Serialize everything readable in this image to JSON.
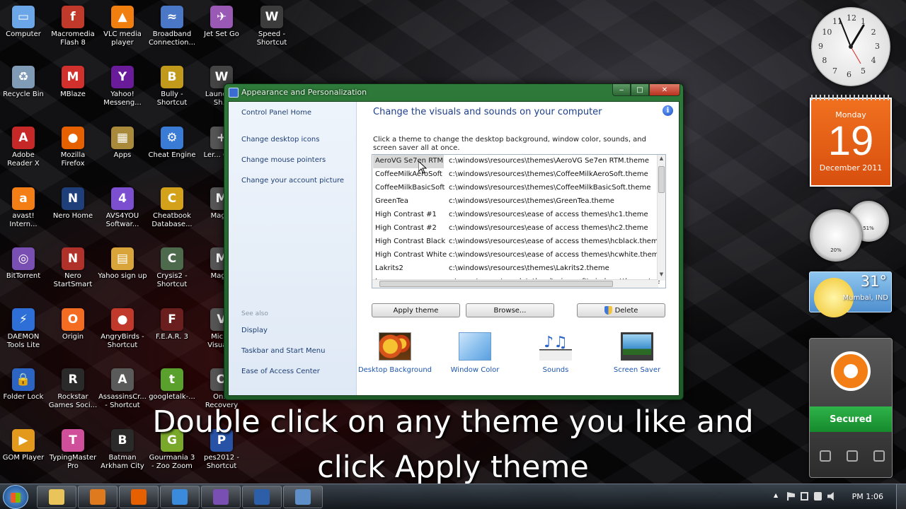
{
  "desktop_icons": [
    {
      "label": "Computer",
      "icon": "computer-icon",
      "color": "#6aa6e8",
      "glyph": "▭"
    },
    {
      "label": "Macromedia Flash 8",
      "icon": "flash-icon",
      "color": "#c0392b",
      "glyph": "f"
    },
    {
      "label": "VLC media player",
      "icon": "vlc-icon",
      "color": "#f07f0f",
      "glyph": "▲"
    },
    {
      "label": "Broadband Connection...",
      "icon": "network-icon",
      "color": "#4a78c7",
      "glyph": "≈"
    },
    {
      "label": "Jet Set Go",
      "icon": "game-icon",
      "color": "#9b59b6",
      "glyph": "✈"
    },
    {
      "label": "Speed - Shortcut",
      "icon": "speed-icon",
      "color": "#3c3c3c",
      "glyph": "W"
    },
    {
      "label": "Recycle Bin",
      "icon": "recycle-bin-icon",
      "color": "#7f9bb5",
      "glyph": "♻"
    },
    {
      "label": "MBlaze",
      "icon": "mblaze-icon",
      "color": "#d0312d",
      "glyph": "M"
    },
    {
      "label": "Yahoo! Messeng...",
      "icon": "yahoo-icon",
      "color": "#6a1b9a",
      "glyph": "Y"
    },
    {
      "label": "Bully - Shortcut",
      "icon": "bully-icon",
      "color": "#c29a1b",
      "glyph": "B"
    },
    {
      "label": "Launc... - Sh...",
      "icon": "launcher-icon",
      "color": "#444",
      "glyph": "W"
    },
    {
      "label": "Adobe Reader X",
      "icon": "adobe-reader-icon",
      "color": "#c62828",
      "glyph": "A"
    },
    {
      "label": "Mozilla Firefox",
      "icon": "firefox-icon",
      "color": "#e66000",
      "glyph": "●"
    },
    {
      "label": "Apps",
      "icon": "apps-icon",
      "color": "#a88a3a",
      "glyph": "▦"
    },
    {
      "label": "Cheat Engine",
      "icon": "cheat-engine-icon",
      "color": "#3a7bd5",
      "glyph": "⚙"
    },
    {
      "label": "Ler... Ga...",
      "icon": "game2-icon",
      "color": "#555",
      "glyph": "+"
    },
    {
      "label": "avast! Intern...",
      "icon": "avast-icon",
      "color": "#f27e15",
      "glyph": "a"
    },
    {
      "label": "Nero Home",
      "icon": "nero-home-icon",
      "color": "#1f3f7a",
      "glyph": "N"
    },
    {
      "label": "AVS4YOU Softwar...",
      "icon": "avs-icon",
      "color": "#7b4fcf",
      "glyph": "4"
    },
    {
      "label": "Cheatbook Database...",
      "icon": "cheatbook-icon",
      "color": "#d4a21a",
      "glyph": "C"
    },
    {
      "label": "Mag...",
      "icon": "mag-icon",
      "color": "#555",
      "glyph": "M"
    },
    {
      "label": "BitTorrent",
      "icon": "bittorrent-icon",
      "color": "#7a4fb3",
      "glyph": "◎"
    },
    {
      "label": "Nero StartSmart",
      "icon": "nero-startsmart-icon",
      "color": "#b0302a",
      "glyph": "N"
    },
    {
      "label": "Yahoo sign up",
      "icon": "yahoo-signup-icon",
      "color": "#d9a43a",
      "glyph": "▤"
    },
    {
      "label": "Crysis2 - Shortcut",
      "icon": "crysis-icon",
      "color": "#4d6a4d",
      "glyph": "C"
    },
    {
      "label": "Mag...",
      "icon": "mag2-icon",
      "color": "#555",
      "glyph": "M"
    },
    {
      "label": "DAEMON Tools Lite",
      "icon": "daemon-tools-icon",
      "color": "#2d6fd6",
      "glyph": "⚡"
    },
    {
      "label": "Origin",
      "icon": "origin-icon",
      "color": "#f36c21",
      "glyph": "O"
    },
    {
      "label": "AngryBirds - Shortcut",
      "icon": "angry-birds-icon",
      "color": "#c0392b",
      "glyph": "●"
    },
    {
      "label": "F.E.A.R. 3",
      "icon": "fear-icon",
      "color": "#6b1e1e",
      "glyph": "F"
    },
    {
      "label": "Micr... Visual...",
      "icon": "visual-icon",
      "color": "#555",
      "glyph": "V"
    },
    {
      "label": "Folder Lock",
      "icon": "folder-lock-icon",
      "color": "#2c64c4",
      "glyph": "🔒"
    },
    {
      "label": "Rockstar Games Soci...",
      "icon": "rockstar-icon",
      "color": "#2a2a2a",
      "glyph": "R"
    },
    {
      "label": "AssassinsCr... - Shortcut",
      "icon": "assassins-creed-icon",
      "color": "#5a5a5a",
      "glyph": "A"
    },
    {
      "label": "googletalk-...",
      "icon": "googletalk-icon",
      "color": "#5aa02c",
      "glyph": "t"
    },
    {
      "label": "On... Recovery",
      "icon": "recovery-icon",
      "color": "#555",
      "glyph": "O"
    },
    {
      "label": "GOM Player",
      "icon": "gom-player-icon",
      "color": "#e39a1c",
      "glyph": "▶"
    },
    {
      "label": "TypingMaster Pro",
      "icon": "typingmaster-icon",
      "color": "#d04f9a",
      "glyph": "T"
    },
    {
      "label": "Batman Arkham City",
      "icon": "batman-icon",
      "color": "#2a2a2a",
      "glyph": "B"
    },
    {
      "label": "Gourmania 3 - Zoo Zoom",
      "icon": "gourmania-icon",
      "color": "#7aa82a",
      "glyph": "G"
    },
    {
      "label": "pes2012 - Shortcut",
      "icon": "pes-icon",
      "color": "#2752a6",
      "glyph": "P"
    }
  ],
  "window": {
    "title": "Appearance and Personalization",
    "minimize": "‒",
    "maximize": "□",
    "close": "✕"
  },
  "nav": {
    "home": "Control Panel Home",
    "links": [
      "Change desktop icons",
      "Change mouse pointers",
      "Change your account picture"
    ],
    "see_also": "See also",
    "see_also_links": [
      "Display",
      "Taskbar and Start Menu",
      "Ease of Access Center"
    ]
  },
  "main": {
    "heading": "Change the visuals and sounds on your computer",
    "info": "i",
    "description": "Click a theme to change the desktop background, window color, sounds, and screen saver all at once.",
    "themes": [
      {
        "name": "AeroVG Se7en RTM",
        "path": "c:\\windows\\resources\\themes\\AeroVG Se7en RTM.theme",
        "selected": true
      },
      {
        "name": "CoffeeMilkAeroSoft",
        "path": "c:\\windows\\resources\\themes\\CoffeeMilkAeroSoft.theme"
      },
      {
        "name": "CoffeeMilkBasicSoft",
        "path": "c:\\windows\\resources\\themes\\CoffeeMilkBasicSoft.theme"
      },
      {
        "name": "GreenTea",
        "path": "c:\\windows\\resources\\themes\\GreenTea.theme"
      },
      {
        "name": "High Contrast #1",
        "path": "c:\\windows\\resources\\ease of access themes\\hc1.theme"
      },
      {
        "name": "High Contrast #2",
        "path": "c:\\windows\\resources\\ease of access themes\\hc2.theme"
      },
      {
        "name": "High Contrast Black",
        "path": "c:\\windows\\resources\\ease of access themes\\hcblack.theme"
      },
      {
        "name": "High Contrast White",
        "path": "c:\\windows\\resources\\ease of access themes\\hcwhite.theme"
      },
      {
        "name": "Lakrits2",
        "path": "c:\\windows\\resources\\themes\\Lakrits2.theme"
      },
      {
        "name": "Lenovo",
        "path": "c:\\users\\croma\\appdata\\local\\microsoft\\windows\\themes\\oe"
      }
    ],
    "buttons": {
      "apply": "Apply theme",
      "browse": "Browse...",
      "delete": "Delete"
    },
    "tiles": [
      {
        "label": "Desktop Background",
        "icon": "desktop-background-icon"
      },
      {
        "label": "Window Color",
        "icon": "window-color-icon"
      },
      {
        "label": "Sounds",
        "icon": "sounds-icon"
      },
      {
        "label": "Screen Saver",
        "icon": "screen-saver-icon"
      }
    ]
  },
  "gadgets": {
    "calendar": {
      "weekday": "Monday",
      "day": "19",
      "month_year": "December 2011"
    },
    "clock_numbers": [
      "12",
      "1",
      "2",
      "3",
      "4",
      "5",
      "6",
      "7",
      "8",
      "9",
      "10",
      "11"
    ],
    "cpu_meter": {
      "small": "51%",
      "large": "20%"
    },
    "weather": {
      "temp": "31°",
      "city": "Mumbai, IND"
    },
    "avast": {
      "status": "Secured"
    }
  },
  "caption": {
    "line1": "Double click on any theme you like and",
    "line2": "click Apply theme"
  },
  "taskbar": {
    "items": [
      {
        "icon": "explorer-icon",
        "color": "#e8c45a"
      },
      {
        "icon": "media-player-icon",
        "color": "#e07a1f"
      },
      {
        "icon": "firefox-icon",
        "color": "#e66000"
      },
      {
        "icon": "internet-explorer-icon",
        "color": "#3a8bdc"
      },
      {
        "icon": "bittorrent-icon",
        "color": "#7a4fb3"
      },
      {
        "icon": "window-icon",
        "color": "#2d5fa8"
      },
      {
        "icon": "control-panel-icon",
        "color": "#5e8fc9"
      }
    ],
    "time": "PM 1:06"
  }
}
